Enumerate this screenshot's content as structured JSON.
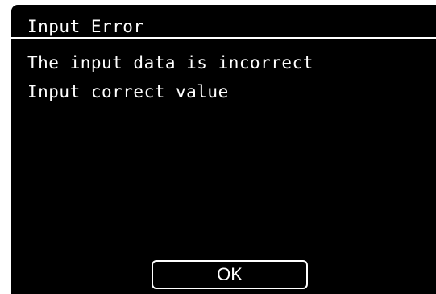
{
  "dialog": {
    "title": "Input Error",
    "messages": [
      "The input data is incorrect",
      "Input correct value"
    ],
    "ok_label": "OK"
  },
  "colors": {
    "background": "#000000",
    "foreground": "#ffffff",
    "page": "#ffffff"
  }
}
